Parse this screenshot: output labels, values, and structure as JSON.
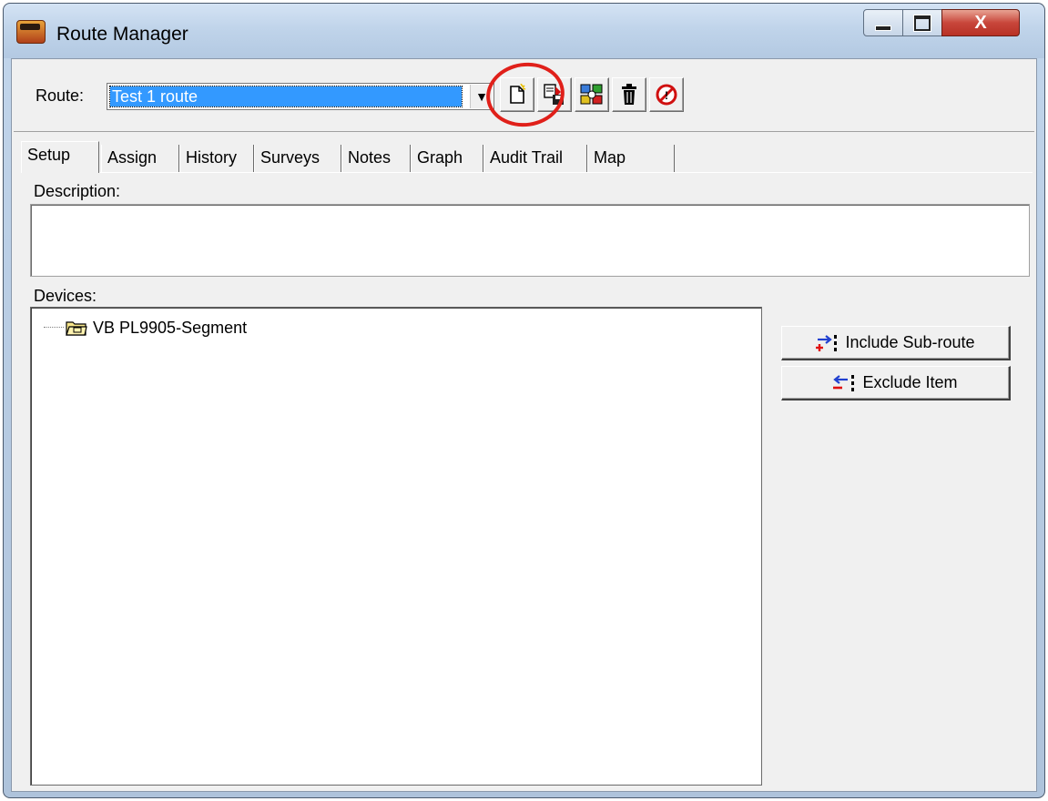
{
  "window": {
    "title": "Route Manager",
    "close_label": "X"
  },
  "toolbar": {
    "route_label": "Route:",
    "route_value": "Test 1 route",
    "buttons": [
      {
        "name": "new-route-icon"
      },
      {
        "name": "save-route-icon"
      },
      {
        "name": "copy-route-icon"
      },
      {
        "name": "delete-route-icon"
      },
      {
        "name": "cancel-icon"
      }
    ],
    "highlight_color": "#e0201a"
  },
  "tabs": [
    {
      "label": "Setup",
      "active": true
    },
    {
      "label": "Assign"
    },
    {
      "label": "History"
    },
    {
      "label": "Surveys"
    },
    {
      "label": "Notes"
    },
    {
      "label": "Graph"
    },
    {
      "label": "Audit Trail"
    },
    {
      "label": "Map"
    }
  ],
  "setup": {
    "description_label": "Description:",
    "description_value": "",
    "devices_label": "Devices:",
    "devices": [
      {
        "label": "VB PL9905-Segment",
        "icon": "folder-icon"
      }
    ],
    "include_button": "Include Sub-route",
    "exclude_button": "Exclude Item"
  }
}
